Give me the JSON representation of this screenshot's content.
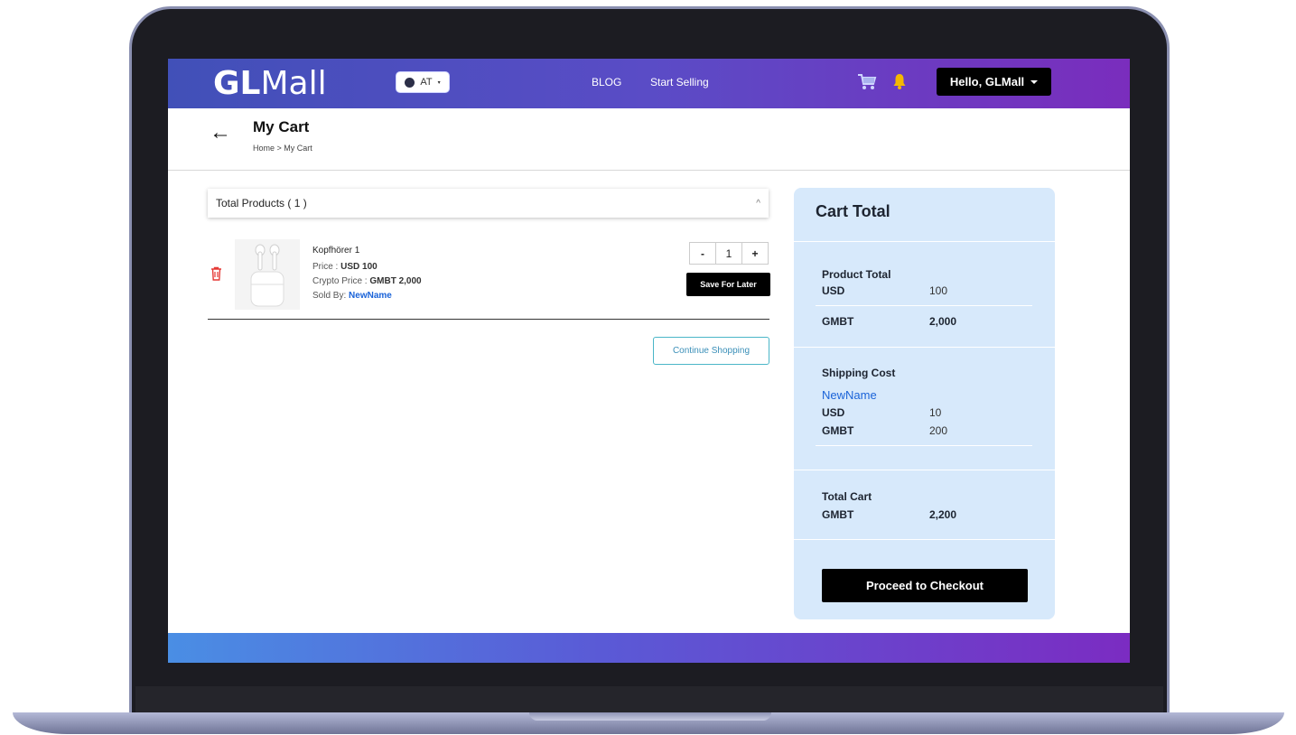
{
  "header": {
    "logo_bold": "GL",
    "logo_light": "Mall",
    "language": "AT",
    "nav": [
      "BLOG",
      "Start Selling"
    ],
    "user_greeting": "Hello, GLMall"
  },
  "page": {
    "title": "My Cart",
    "breadcrumb": "Home > My Cart"
  },
  "products": {
    "header": "Total Products ( 1 )",
    "items": [
      {
        "name": "Kopfhörer 1",
        "price_label": "Price : ",
        "price": "USD 100",
        "crypto_label": "Crypto Price : ",
        "crypto_price": "GMBT 2,000",
        "sold_label": "Sold By: ",
        "seller": "NewName",
        "quantity": "1",
        "minus": "-",
        "plus": "+",
        "save_for_later": "Save For Later"
      }
    ],
    "continue_shopping": "Continue Shopping"
  },
  "cart_total": {
    "title": "Cart Total",
    "product_total_label": "Product Total",
    "usd_label": "USD",
    "product_usd": "100",
    "gmbt_label": "GMBT",
    "product_gmbt": "2,000",
    "shipping_label": "Shipping Cost",
    "shipping_seller": "NewName",
    "shipping_usd": "10",
    "shipping_gmbt": "200",
    "total_cart_label": "Total Cart",
    "total_gmbt": "2,200",
    "checkout": "Proceed to Checkout"
  },
  "colors": {
    "header_gradient_start": "#4150b8",
    "header_gradient_end": "#7a2dbd",
    "cart_panel": "#d7e9fb",
    "link_blue": "#1a63d8",
    "trash_red": "#e53935",
    "bell_yellow": "#f5b800"
  }
}
